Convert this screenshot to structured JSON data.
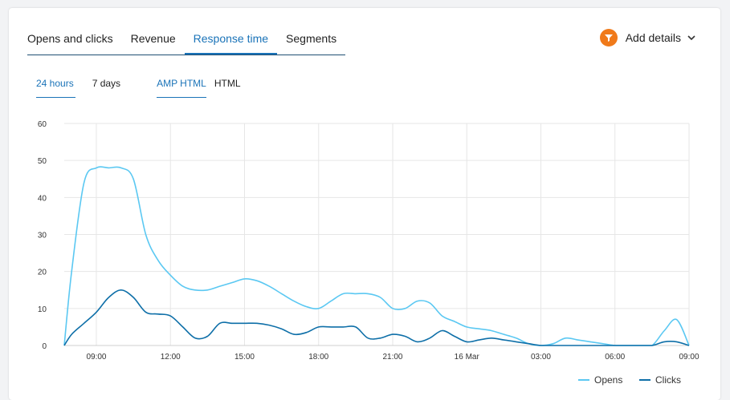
{
  "tabs": [
    {
      "label": "Opens and clicks",
      "active": false
    },
    {
      "label": "Revenue",
      "active": false
    },
    {
      "label": "Response time",
      "active": true
    },
    {
      "label": "Segments",
      "active": false
    }
  ],
  "add_details": {
    "label": "Add details",
    "icon": "filter-icon",
    "accent": "#f07a1a"
  },
  "range_tabs": [
    {
      "label": "24 hours",
      "active": true
    },
    {
      "label": "7 days",
      "active": false
    }
  ],
  "format_tabs": [
    {
      "label": "AMP HTML",
      "active": true
    },
    {
      "label": "HTML",
      "active": false
    }
  ],
  "chart_data": {
    "type": "line",
    "title": "",
    "xlabel": "",
    "ylabel": "",
    "ylim": [
      0,
      60
    ],
    "yticks": [
      0,
      10,
      20,
      30,
      40,
      50,
      60
    ],
    "x": [
      7.7,
      8,
      8.5,
      9,
      9.5,
      10,
      10.5,
      11,
      11.5,
      12,
      12.5,
      13,
      13.5,
      14,
      14.5,
      15,
      15.5,
      16,
      16.5,
      17,
      17.5,
      18,
      18.5,
      19,
      19.5,
      20,
      20.5,
      21,
      21.5,
      22,
      22.5,
      23,
      23.5,
      24,
      24.5,
      25,
      25.5,
      26,
      26.5,
      27,
      27.5,
      28,
      28.5,
      29,
      29.5,
      30,
      30.5,
      31,
      31.5,
      32,
      32.5,
      33
    ],
    "xlim": [
      7.7,
      33
    ],
    "xticks": [
      {
        "value": 9,
        "label": "09:00"
      },
      {
        "value": 12,
        "label": "12:00"
      },
      {
        "value": 15,
        "label": "15:00"
      },
      {
        "value": 18,
        "label": "18:00"
      },
      {
        "value": 21,
        "label": "21:00"
      },
      {
        "value": 24,
        "label": "16 Mar"
      },
      {
        "value": 27,
        "label": "03:00"
      },
      {
        "value": 30,
        "label": "06:00"
      },
      {
        "value": 33,
        "label": "09:00"
      }
    ],
    "grid": true,
    "legend_position": "bottom-right",
    "series": [
      {
        "name": "Opens",
        "color": "#5bc8f2",
        "values": [
          0,
          20,
          44,
          48,
          48,
          48,
          45,
          30,
          23,
          19,
          16,
          15,
          15,
          16,
          17,
          18,
          17.5,
          16,
          14,
          12,
          10.5,
          10,
          12,
          14,
          14,
          14,
          13,
          10,
          10,
          12,
          11.5,
          8,
          6.5,
          5,
          4.5,
          4,
          3,
          2,
          0.5,
          0,
          0.5,
          2,
          1.5,
          1,
          0.5,
          0,
          0,
          0,
          0,
          4,
          7,
          0
        ]
      },
      {
        "name": "Clicks",
        "color": "#0e6fa8",
        "values": [
          0,
          3,
          6,
          9,
          13,
          15,
          13,
          9,
          8.5,
          8,
          5,
          2,
          2.5,
          6,
          6,
          6,
          6,
          5.5,
          4.5,
          3,
          3.5,
          5,
          5,
          5,
          5,
          2,
          2,
          3,
          2.5,
          1,
          2,
          4,
          2.5,
          1,
          1.5,
          2,
          1.5,
          1,
          0.5,
          0,
          0,
          0,
          0,
          0,
          0,
          0,
          0,
          0,
          0,
          1,
          1,
          0
        ]
      }
    ]
  }
}
